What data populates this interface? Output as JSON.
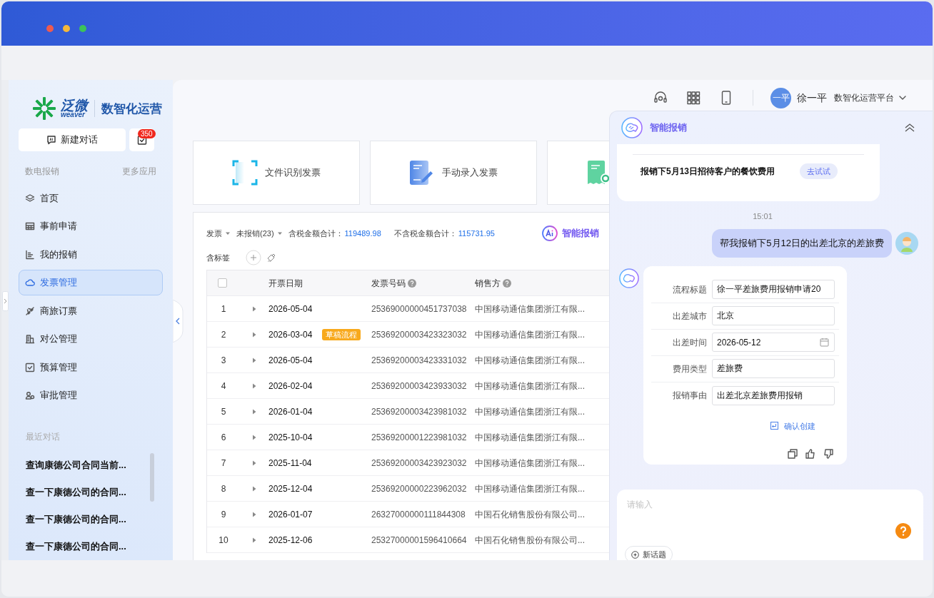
{
  "sidebar": {
    "logo": {
      "brand": "泛微",
      "brand_latin": "weaver",
      "product": "数智化运营"
    },
    "new_chat_button": "新建对话",
    "todo_count": "350",
    "section_label": "数电报销",
    "more_link": "更多应用",
    "nav_items": [
      {
        "label": "首页",
        "selected": false
      },
      {
        "label": "事前申请",
        "selected": false
      },
      {
        "label": "我的报销",
        "selected": false
      },
      {
        "label": "发票管理",
        "selected": true
      },
      {
        "label": "商旅订票",
        "selected": false
      },
      {
        "label": "对公管理",
        "selected": false
      },
      {
        "label": "预算管理",
        "selected": false
      },
      {
        "label": "审批管理",
        "selected": false
      }
    ],
    "recent_label": "最近对话",
    "recent_items": [
      "查询康德公司合同当前...",
      "查一下康德公司的合同...",
      "查一下康德公司的合同...",
      "查一下康德公司的合同..."
    ]
  },
  "header": {
    "user_avatar": "一平",
    "user_name": "徐一平",
    "platform": "数智化运营平台"
  },
  "actions": [
    {
      "kind": "scan",
      "label": "文件识别发票"
    },
    {
      "kind": "manual",
      "label": "手动录入发票"
    },
    {
      "kind": "receipt"
    }
  ],
  "filters": {
    "type_filter": "发票",
    "status_filter": "未报销(23)",
    "tax_total_label": "含税金额合计：",
    "tax_total": "119489.98",
    "net_total_label": "不含税金额合计：",
    "net_total": "115731.95",
    "ai_button": "智能报销",
    "tags_label": "含标签"
  },
  "table": {
    "header_checked": false,
    "columns": [
      {
        "label": "开票日期",
        "help": false
      },
      {
        "label": "发票号码",
        "help": true
      },
      {
        "label": "销售方",
        "help": true
      }
    ],
    "rows": [
      {
        "index": "1",
        "date": "2026-05-04",
        "number": "25369000000451737038",
        "seller": "中国移动通信集团浙江有限..."
      },
      {
        "index": "2",
        "date": "2026-03-04",
        "tag": "草稿流程",
        "number": "25369200003423323032",
        "seller": "中国移动通信集团浙江有限..."
      },
      {
        "index": "3",
        "date": "2026-05-04",
        "number": "25369200003423331032",
        "seller": "中国移动通信集团浙江有限..."
      },
      {
        "index": "4",
        "date": "2026-02-04",
        "number": "25369200003423933032",
        "seller": "中国移动通信集团浙江有限..."
      },
      {
        "index": "5",
        "date": "2026-01-04",
        "number": "25369200003423981032",
        "seller": "中国移动通信集团浙江有限..."
      },
      {
        "index": "6",
        "date": "2025-10-04",
        "number": "25369200001223981032",
        "seller": "中国移动通信集团浙江有限..."
      },
      {
        "index": "7",
        "date": "2025-11-04",
        "number": "25369200003423923032",
        "seller": "中国移动通信集团浙江有限..."
      },
      {
        "index": "8",
        "date": "2025-12-04",
        "number": "25369200000223962032",
        "seller": "中国移动通信集团浙江有限..."
      },
      {
        "index": "9",
        "date": "2026-01-07",
        "number": "26327000000111844308",
        "seller": "中国石化销售股份有限公司..."
      },
      {
        "index": "10",
        "date": "2025-12-06",
        "number": "25327000001596410664",
        "seller": "中国石化销售股份有限公司..."
      }
    ]
  },
  "chat": {
    "title": "智能报销",
    "suggestion": "报销下5月13日招待客户的餐饮费用",
    "try_button": "去试试",
    "time": "15:01",
    "user_message": "帮我报销下5月12日的出差北京的差旅费",
    "form": [
      {
        "kind": "text",
        "label": "流程标题",
        "value": "徐一平差旅费用报销申请20"
      },
      {
        "kind": "text",
        "label": "出差城市",
        "value": "北京"
      },
      {
        "kind": "date",
        "label": "出差时间",
        "value": "2026-05-12"
      },
      {
        "kind": "text",
        "label": "费用类型",
        "value": "差旅费"
      },
      {
        "kind": "text",
        "label": "报销事由",
        "value": "出差北京差旅费用报销"
      }
    ],
    "confirm": "确认创建",
    "input_placeholder": "请输入",
    "new_topic": "新话题"
  }
}
